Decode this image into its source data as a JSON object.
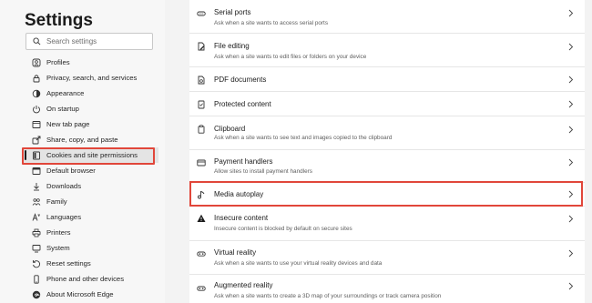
{
  "sidebar": {
    "title": "Settings",
    "search": {
      "placeholder": "Search settings",
      "icon": "search-icon"
    },
    "items": [
      {
        "label": "Profiles",
        "icon": "profile-icon"
      },
      {
        "label": "Privacy, search, and services",
        "icon": "lock-icon"
      },
      {
        "label": "Appearance",
        "icon": "appearance-icon"
      },
      {
        "label": "On startup",
        "icon": "power-icon"
      },
      {
        "label": "New tab page",
        "icon": "new-tab-icon"
      },
      {
        "label": "Share, copy, and paste",
        "icon": "share-icon"
      },
      {
        "label": "Cookies and site permissions",
        "icon": "site-permissions-icon",
        "active": true
      },
      {
        "label": "Default browser",
        "icon": "browser-icon"
      },
      {
        "label": "Downloads",
        "icon": "download-icon"
      },
      {
        "label": "Family",
        "icon": "family-icon"
      },
      {
        "label": "Languages",
        "icon": "language-icon"
      },
      {
        "label": "Printers",
        "icon": "printer-icon"
      },
      {
        "label": "System",
        "icon": "system-icon"
      },
      {
        "label": "Reset settings",
        "icon": "reset-icon"
      },
      {
        "label": "Phone and other devices",
        "icon": "phone-icon"
      },
      {
        "label": "About Microsoft Edge",
        "icon": "edge-icon"
      }
    ]
  },
  "permissions": [
    {
      "title": "Serial ports",
      "desc": "Ask when a site wants to access serial ports",
      "icon": "serial-port-icon"
    },
    {
      "title": "File editing",
      "desc": "Ask when a site wants to edit files or folders on your device",
      "icon": "file-edit-icon"
    },
    {
      "title": "PDF documents",
      "desc": "",
      "icon": "pdf-icon"
    },
    {
      "title": "Protected content",
      "desc": "",
      "icon": "protected-content-icon"
    },
    {
      "title": "Clipboard",
      "desc": "Ask when a site wants to see text and images copied to the clipboard",
      "icon": "clipboard-icon"
    },
    {
      "title": "Payment handlers",
      "desc": "Allow sites to install payment handlers",
      "icon": "payment-icon"
    },
    {
      "title": "Media autoplay",
      "desc": "",
      "icon": "media-autoplay-icon",
      "highlighted": true
    },
    {
      "title": "Insecure content",
      "desc": "Insecure content is blocked by default on secure sites",
      "icon": "warning-icon"
    },
    {
      "title": "Virtual reality",
      "desc": "Ask when a site wants to use your virtual reality devices and data",
      "icon": "vr-icon"
    },
    {
      "title": "Augmented reality",
      "desc": "Ask when a site wants to create a 3D map of your surroundings or track camera position",
      "icon": "ar-icon"
    }
  ],
  "colors": {
    "highlight": "#e1463a",
    "background": "#f3f3f3",
    "card": "#ffffff"
  }
}
